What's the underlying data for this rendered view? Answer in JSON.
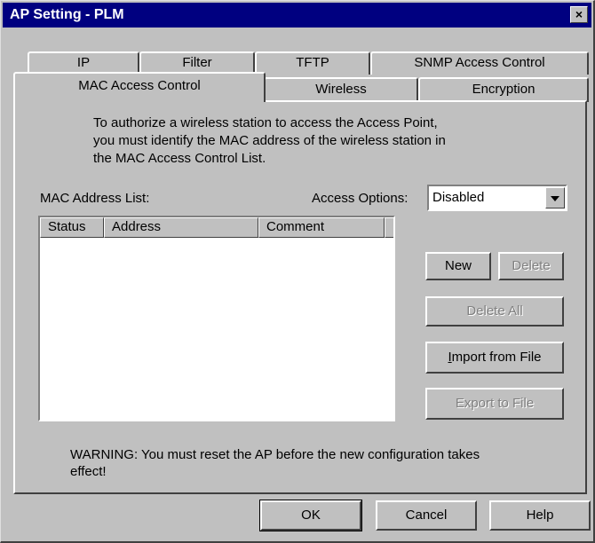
{
  "window": {
    "title": "AP Setting - PLM",
    "close_glyph": "×"
  },
  "tabs": {
    "row1": [
      "IP",
      "Filter",
      "TFTP",
      "SNMP Access Control"
    ],
    "row2": [
      "MAC Access Control",
      "Wireless",
      "Encryption"
    ],
    "active": "MAC Access Control"
  },
  "info": {
    "lines": [
      "To authorize a wireless station to access the Access Point,",
      "you must identify the MAC address of the wireless station in",
      "the MAC Access Control List."
    ]
  },
  "mac_list": {
    "label": "MAC Address List:",
    "columns": [
      "Status",
      "Address",
      "Comment"
    ]
  },
  "access_options": {
    "label": "Access Options:",
    "value": "Disabled"
  },
  "buttons": {
    "new": "New",
    "delete": "Delete",
    "delete_all": "Delete All",
    "import_prefix": "I",
    "import_rest": "mport from File",
    "export": "Export to File"
  },
  "warning": {
    "lines": [
      "WARNING: You must reset the AP before the new configuration takes",
      "effect!"
    ]
  },
  "footer": {
    "ok": "OK",
    "cancel": "Cancel",
    "help": "Help"
  }
}
